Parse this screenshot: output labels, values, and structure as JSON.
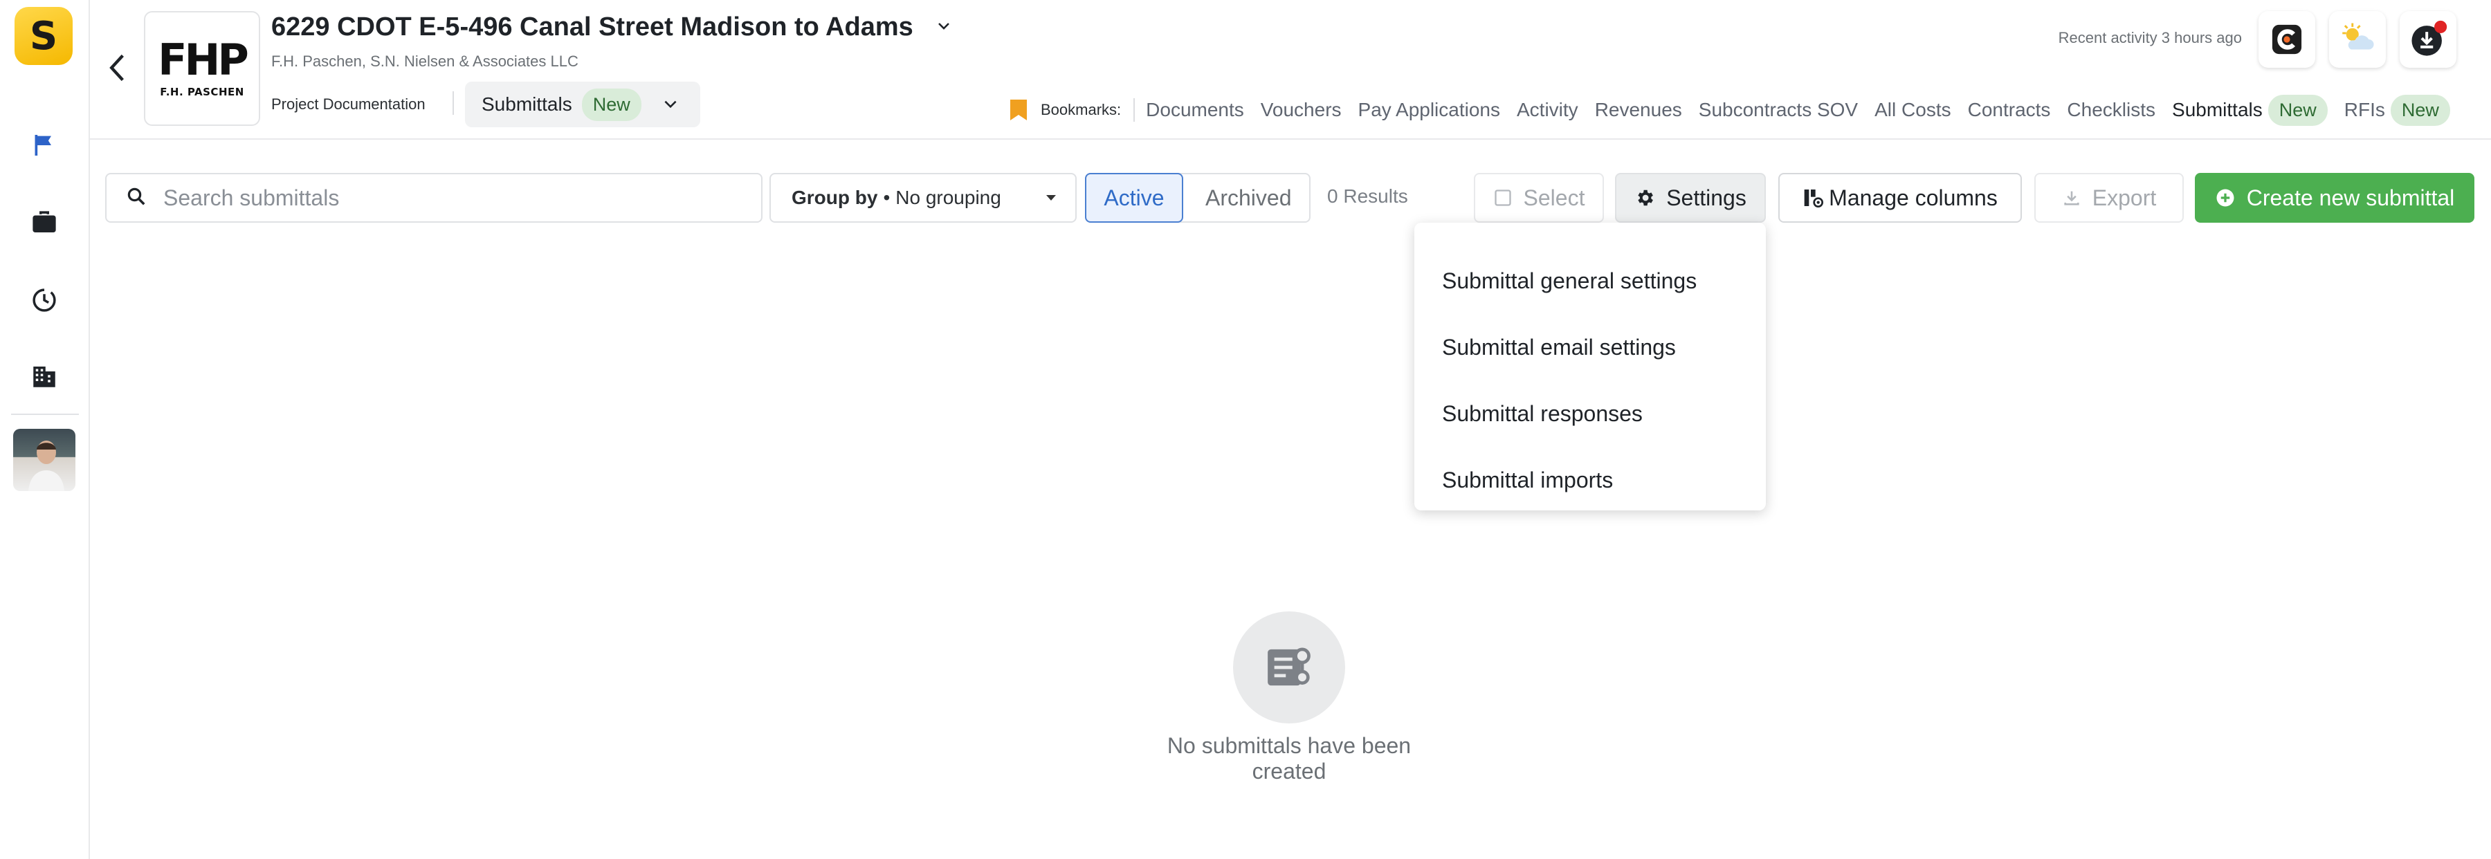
{
  "app": {
    "logo_letter": "S"
  },
  "rail": {
    "items": [
      {
        "name": "flag-icon"
      },
      {
        "name": "briefcase-icon"
      },
      {
        "name": "history-icon"
      },
      {
        "name": "building-icon"
      }
    ]
  },
  "header": {
    "company_logo_mark": "FHP",
    "company_logo_text": "F.H. PASCHEN",
    "title": "6229 CDOT E-5-496 Canal Street Madison to Adams",
    "subtitle": "F.H. Paschen, S.N. Nielsen & Associates LLC",
    "breadcrumb_label": "Project Documentation",
    "module_label": "Submittals",
    "module_badge": "New",
    "recent_activity": "Recent activity 3 hours ago"
  },
  "bookmarks": {
    "label": "Bookmarks:",
    "links": [
      "Documents",
      "Vouchers",
      "Pay Applications",
      "Activity",
      "Revenues",
      "Subcontracts SOV",
      "All Costs",
      "Contracts",
      "Checklists"
    ],
    "active_link": "Submittals",
    "active_badge": "New",
    "rfis_link": "RFIs",
    "rfis_badge": "New"
  },
  "toolbar": {
    "search_placeholder": "Search submittals",
    "groupby_label": "Group by",
    "groupby_value": "No grouping",
    "segment_active": "Active",
    "segment_archived": "Archived",
    "results_count": "0 Results",
    "select_label": "Select",
    "settings_label": "Settings",
    "manage_columns_label": "Manage columns",
    "export_label": "Export",
    "create_label": "Create new submittal"
  },
  "settings_menu": {
    "items": [
      "Submittal general settings",
      "Submittal email settings",
      "Submittal responses",
      "Submittal imports"
    ]
  },
  "empty_state": {
    "message": "No submittals have been created"
  },
  "colors": {
    "accent_green": "#4caf50",
    "accent_blue": "#2f6bc7",
    "badge_green_bg": "#d9ecd9",
    "brand_yellow": "#f5b800"
  }
}
